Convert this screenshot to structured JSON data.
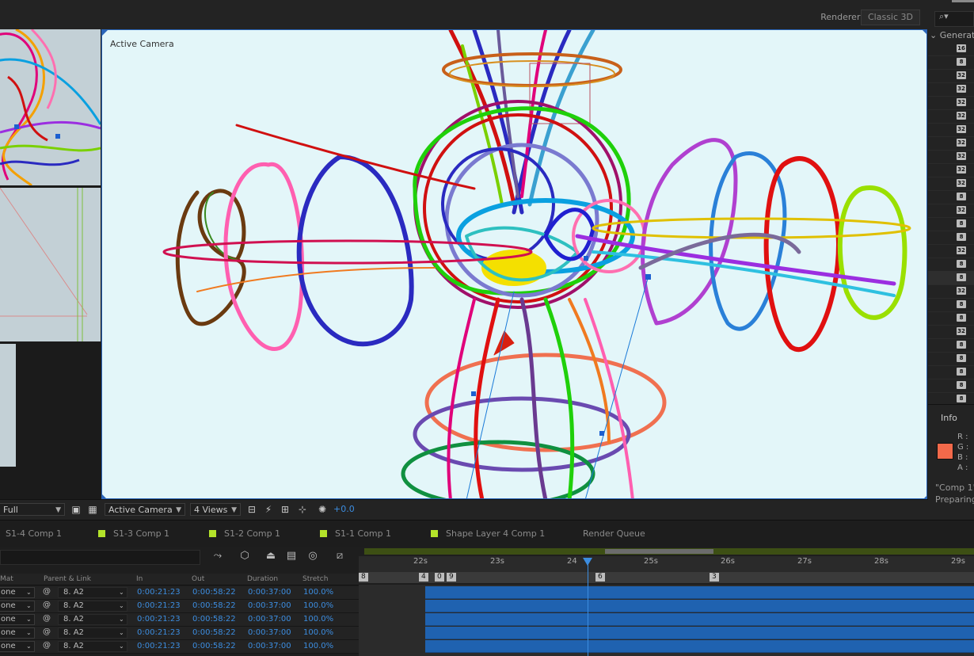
{
  "renderer": {
    "label": "Renderer:",
    "value": "Classic 3D"
  },
  "viewer": {
    "camera_label": "Active Camera"
  },
  "viewer_toolbar": {
    "resolution": "Full",
    "camera_view": "Active Camera",
    "views": "4 Views",
    "exposure": "+0.0"
  },
  "right_panel": {
    "group": "Generat",
    "badges": [
      "16",
      "8",
      "32",
      "32",
      "32",
      "32",
      "32",
      "32",
      "32",
      "32",
      "32",
      "8",
      "32",
      "8",
      "8",
      "32",
      "8",
      "8",
      "32",
      "8",
      "8",
      "32",
      "8",
      "8",
      "8",
      "8",
      "8",
      "8"
    ]
  },
  "info": {
    "title": "Info",
    "swatch_color": "#f2694a",
    "channels": [
      "R :",
      "G :",
      "B :",
      "A :"
    ],
    "comp_line": "\"Comp 1\"",
    "status": "Preparing"
  },
  "tabs": [
    {
      "label": "S1-4 Comp 1",
      "swatch": false
    },
    {
      "label": "S1-3 Comp 1",
      "swatch": true
    },
    {
      "label": "S1-2 Comp 1",
      "swatch": true
    },
    {
      "label": "S1-1 Comp 1",
      "swatch": true
    },
    {
      "label": "Shape Layer 4 Comp 1",
      "swatch": true
    },
    {
      "label": "Render Queue",
      "swatch": false
    }
  ],
  "timeline": {
    "columns": {
      "mat": "Mat",
      "parent": "Parent & Link",
      "in": "In",
      "out": "Out",
      "duration": "Duration",
      "stretch": "Stretch"
    },
    "rows": [
      {
        "mat": "one",
        "parent": "8. A2",
        "in": "0:00:21:23",
        "out": "0:00:58:22",
        "duration": "0:00:37:00",
        "stretch": "100.0%"
      },
      {
        "mat": "one",
        "parent": "8. A2",
        "in": "0:00:21:23",
        "out": "0:00:58:22",
        "duration": "0:00:37:00",
        "stretch": "100.0%"
      },
      {
        "mat": "one",
        "parent": "8. A2",
        "in": "0:00:21:23",
        "out": "0:00:58:22",
        "duration": "0:00:37:00",
        "stretch": "100.0%"
      },
      {
        "mat": "one",
        "parent": "8. A2",
        "in": "0:00:21:23",
        "out": "0:00:58:22",
        "duration": "0:00:37:00",
        "stretch": "100.0%"
      },
      {
        "mat": "one",
        "parent": "8. A2",
        "in": "0:00:21:23",
        "out": "0:00:58:22",
        "duration": "0:00:37:00",
        "stretch": "100.0%"
      }
    ],
    "ruler_ticks": [
      "22s",
      "23s",
      "24",
      "25s",
      "26s",
      "27s",
      "28s",
      "29s"
    ],
    "markers": [
      "8",
      "4",
      "0",
      "9",
      "6",
      "3"
    ]
  }
}
